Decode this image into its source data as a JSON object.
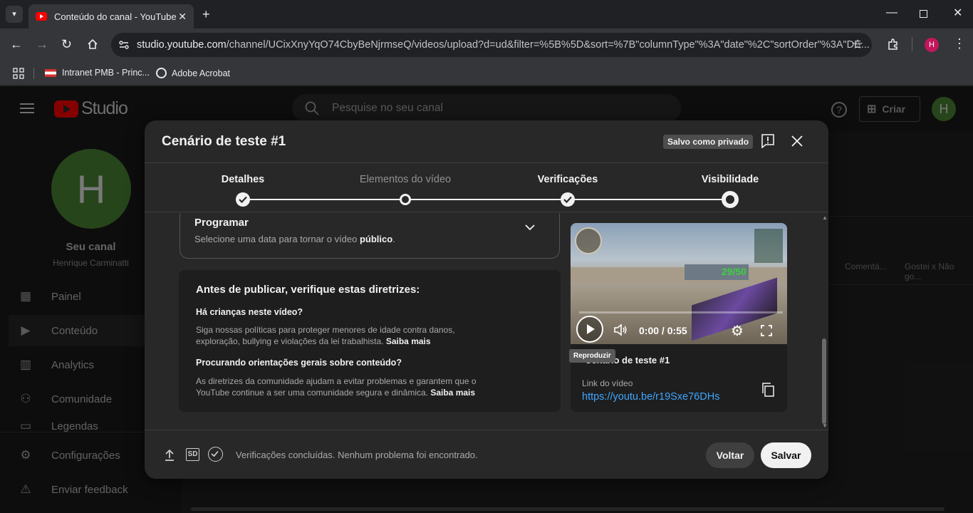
{
  "browser": {
    "tab_title": "Conteúdo do canal - YouTube S",
    "url_main": "studio.youtube.com",
    "url_rest": "/channel/UCixXnyYqO74CbyBeNjrmseQ/videos/upload?d=ud&filter=%5B%5D&sort=%7B\"columnType\"%3A\"date\"%2C\"sortOrder\"%3A\"DE...",
    "profile_initial": "H",
    "bookmarks": [
      "Intranet PMB - Princ...",
      "Adobe Acrobat"
    ]
  },
  "studio": {
    "logo_text": "Studio",
    "search_placeholder": "Pesquise no seu canal",
    "create_label": "Criar",
    "avatar_initial": "H",
    "channel_label": "Seu canal",
    "channel_owner": "Henrique Carminatti",
    "nav": [
      {
        "label": "Painel"
      },
      {
        "label": "Conteúdo"
      },
      {
        "label": "Analytics"
      },
      {
        "label": "Comunidade"
      },
      {
        "label": "Legendas"
      },
      {
        "label": "Configurações"
      },
      {
        "label": "Enviar feedback"
      }
    ],
    "bg_columns": [
      "Comentá...",
      "Gostei x Não go..."
    ]
  },
  "dialog": {
    "title": "Cenário de teste #1",
    "saved_badge": "Salvo como privado",
    "steps": [
      {
        "label": "Detalhes",
        "state": "done"
      },
      {
        "label": "Elementos do vídeo",
        "state": "skipped"
      },
      {
        "label": "Verificações",
        "state": "done"
      },
      {
        "label": "Visibilidade",
        "state": "current"
      }
    ],
    "schedule": {
      "title": "Programar",
      "desc_prefix": "Selecione uma data para tornar o vídeo ",
      "desc_bold": "público",
      "desc_suffix": "."
    },
    "guidelines": {
      "heading": "Antes de publicar, verifique estas diretrizes:",
      "q1": "Há crianças neste vídeo?",
      "a1_line1": "Siga nossas políticas para proteger menores de idade contra danos,",
      "a1_line2": "exploração, bullying e violações da lei trabalhista.",
      "q2": "Procurando orientações gerais sobre conteúdo?",
      "a2_line1": "As diretrizes da comunidade ajudam a evitar problemas e garantem que o",
      "a2_line2": "YouTube continue a ser uma comunidade segura e dinâmica.",
      "learn_more": "Saiba mais"
    },
    "video": {
      "time": "0:00 / 0:55",
      "tooltip": "Reproduzir",
      "title_visible": "Cenário de teste #1",
      "link_label": "Link do vídeo",
      "link_url": "https://youtu.be/r19Sxe76DHs",
      "hud_score": "29/50"
    },
    "footer": {
      "status": "Verificações concluídas. Nenhum problema foi encontrado.",
      "sd_badge": "SD",
      "back_label": "Voltar",
      "save_label": "Salvar"
    }
  }
}
